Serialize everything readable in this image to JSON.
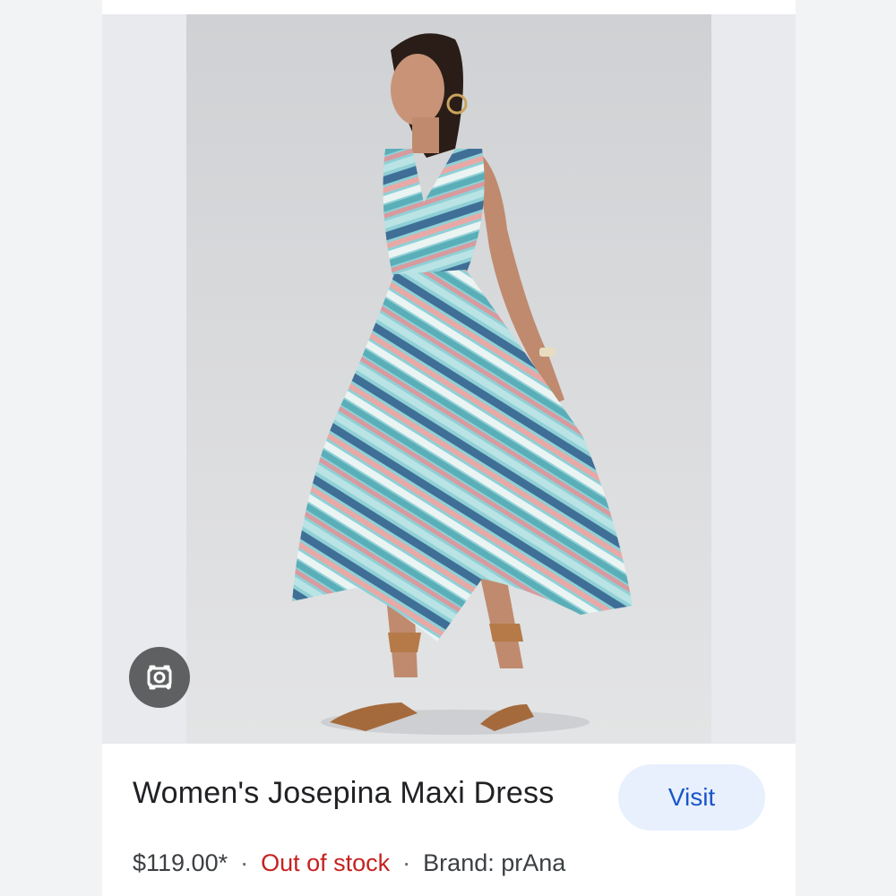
{
  "product": {
    "title": "Women's Josepina Maxi Dress",
    "price": "$119.00*",
    "separator": "·",
    "stock_status": "Out of stock",
    "brand": "Brand: prAna"
  },
  "actions": {
    "visit_label": "Visit"
  },
  "icons": {
    "lens": "camera-search-icon"
  },
  "colors": {
    "accent": "#1a56c9",
    "visit_bg": "#e8f0fe",
    "out_of_stock": "#c5221f",
    "text_primary": "#202124"
  }
}
